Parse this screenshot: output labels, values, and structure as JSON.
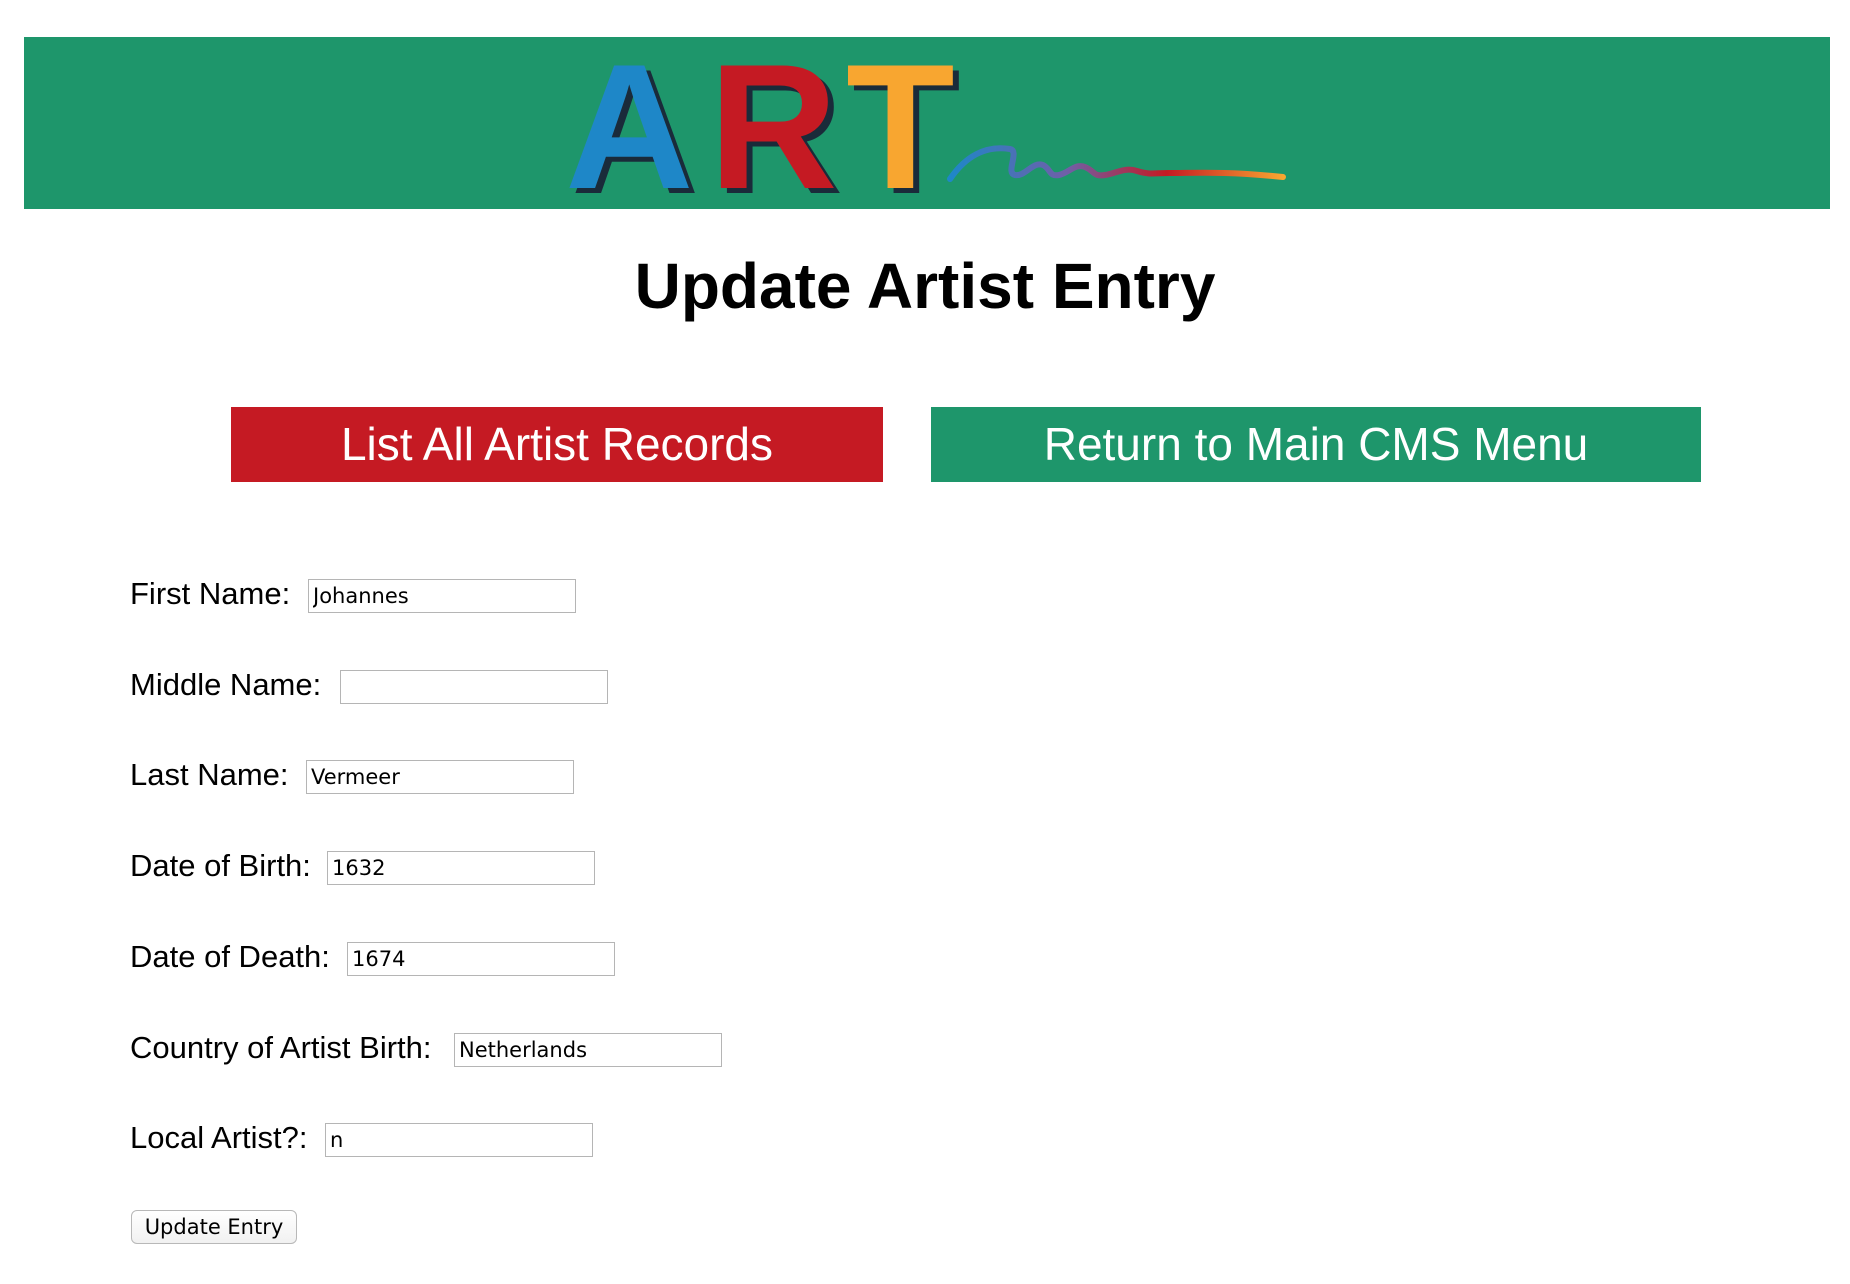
{
  "colors": {
    "banner": "#1e966b",
    "list_button": "#c51a23",
    "return_button": "#1e966b",
    "logo_a": "#1e87c8",
    "logo_r": "#c51a23",
    "logo_t": "#f8a630"
  },
  "logo": {
    "letters": [
      "A",
      "R",
      "T"
    ],
    "icon": "art-logo-with-brushstroke"
  },
  "page": {
    "title": "Update Artist Entry"
  },
  "nav": {
    "list_all": "List All Artist Records",
    "return_main": "Return to Main CMS Menu"
  },
  "form": {
    "fields": [
      {
        "label": "First Name:",
        "value": "Johannes"
      },
      {
        "label": "Middle Name:",
        "value": ""
      },
      {
        "label": "Last Name:",
        "value": "Vermeer"
      },
      {
        "label": "Date of Birth:",
        "value": "1632"
      },
      {
        "label": "Date of Death:",
        "value": "1674"
      },
      {
        "label": "Country of Artist Birth:",
        "value": "Netherlands"
      },
      {
        "label": "Local Artist?:",
        "value": "n"
      }
    ],
    "submit_label": "Update Entry"
  }
}
